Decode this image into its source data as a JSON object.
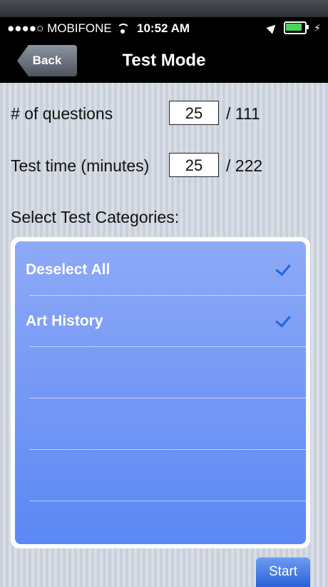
{
  "status": {
    "carrier": "●●●●○ MOBIFONE",
    "time": "10:52 AM"
  },
  "navbar": {
    "back_label": "Back",
    "title": "Test Mode"
  },
  "form": {
    "questions_label": "# of questions",
    "questions_value": "25",
    "questions_max": "/ 111",
    "time_label": "Test time (minutes)",
    "time_value": "25",
    "time_max": "/ 222",
    "categories_label": "Select Test Categories:"
  },
  "list": {
    "items": [
      {
        "label": "Deselect All",
        "checked": true
      },
      {
        "label": "Art History",
        "checked": true
      }
    ]
  },
  "actions": {
    "start_label": "Start"
  },
  "colors": {
    "accent": "#1e66e6",
    "list_top": "#8ea9f7",
    "list_bottom": "#5b88f5"
  }
}
